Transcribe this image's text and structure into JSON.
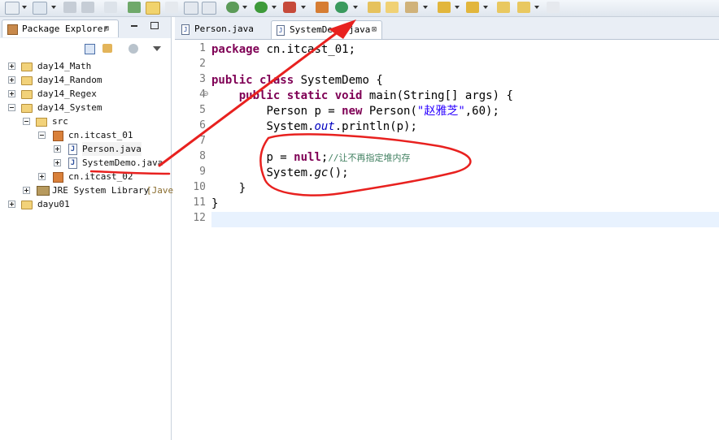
{
  "package_explorer": {
    "tab_label": "Package Explorer",
    "close_glyph": "⊠",
    "tree": [
      {
        "label": "day14_Math",
        "expanded": false
      },
      {
        "label": "day14_Random",
        "expanded": false
      },
      {
        "label": "day14_Regex",
        "expanded": false
      },
      {
        "label": "day14_System",
        "expanded": true
      },
      {
        "label": "src",
        "expanded": true
      },
      {
        "label": "cn.itcast_01",
        "expanded": true
      },
      {
        "label": "Person.java",
        "expanded": false
      },
      {
        "label": "SystemDemo.java",
        "expanded": false
      },
      {
        "label": "cn.itcast_02",
        "expanded": false
      },
      {
        "label": "JRE System Library",
        "suffix": "[Jave",
        "expanded": false
      },
      {
        "label": "dayu01",
        "expanded": false
      }
    ]
  },
  "editor": {
    "tabs": [
      {
        "label": "Person.java",
        "active": false
      },
      {
        "label": "SystemDemo.java",
        "active": true,
        "close_glyph": "⊠"
      }
    ],
    "line_numbers": [
      "1",
      "2",
      "3",
      "4",
      "5",
      "6",
      "7",
      "8",
      "9",
      "10",
      "11",
      "12"
    ],
    "code": {
      "l1_kw": "package",
      "l1_rest": " cn.itcast_01;",
      "l3_kw1": "public",
      "l3_kw2": "class",
      "l3_rest": " SystemDemo {",
      "l4_kw1": "public",
      "l4_kw2": "static",
      "l4_kw3": "void",
      "l4_rest": " main(String[] args) {",
      "l5_a": "Person p = ",
      "l5_kw": "new",
      "l5_b": " Person(",
      "l5_str": "\"赵雅芝\"",
      "l5_c": ",60);",
      "l6_a": "System.",
      "l6_it": "out",
      "l6_b": ".println(p);",
      "l8_a": "p = ",
      "l8_kw": "null",
      "l8_b": ";",
      "l8_cmt": "//让不再指定堆内存",
      "l9_a": "System.",
      "l9_it": "gc",
      "l9_b": "();",
      "l10": "}",
      "l11": "}"
    }
  },
  "colors": {
    "keyword": "#7f0055",
    "string": "#2a00ff",
    "comment": "#3f7f5f",
    "field": "#0000c0",
    "annotation": "#e8211f",
    "current_line": "#e8f2fe"
  }
}
